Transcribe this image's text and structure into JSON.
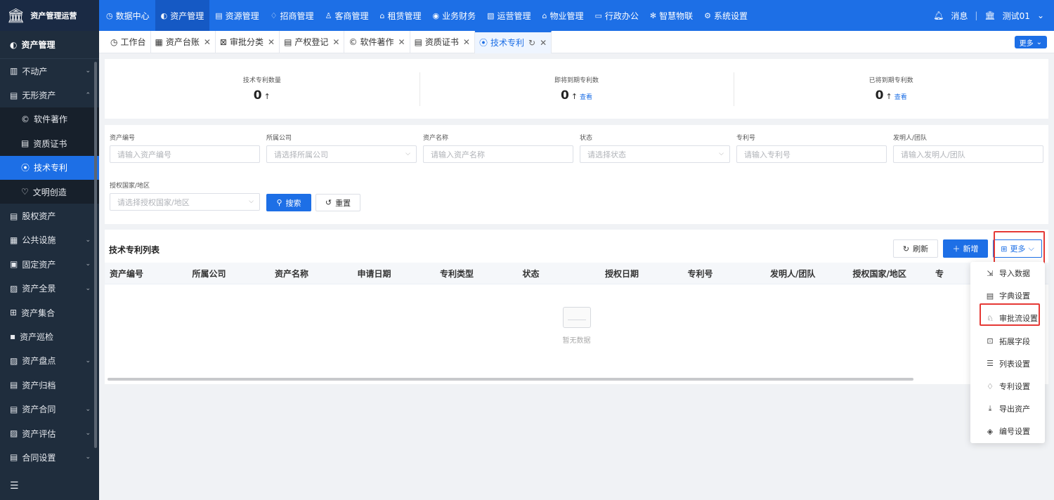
{
  "brand": {
    "name": "资产管理运营"
  },
  "topnav": [
    {
      "label": "数据中心",
      "icon": "◷"
    },
    {
      "label": "资产管理",
      "icon": "◐"
    },
    {
      "label": "资源管理",
      "icon": "▤"
    },
    {
      "label": "招商管理",
      "icon": "♢"
    },
    {
      "label": "客商管理",
      "icon": "♙"
    },
    {
      "label": "租赁管理",
      "icon": "⌂"
    },
    {
      "label": "业务财务",
      "icon": "◉"
    },
    {
      "label": "运营管理",
      "icon": "▧"
    },
    {
      "label": "物业管理",
      "icon": "⌂"
    },
    {
      "label": "行政办公",
      "icon": "▭"
    },
    {
      "label": "智慧物联",
      "icon": "✻"
    },
    {
      "label": "系统设置",
      "icon": "⚙"
    }
  ],
  "topright": {
    "messages": "消息",
    "user": "测试01"
  },
  "sidebar": {
    "title": "资产管理",
    "items": [
      {
        "label": "不动产",
        "icon": "▥",
        "chevron": "⌄"
      },
      {
        "label": "无形资产",
        "icon": "▤",
        "chevron": "⌃"
      },
      {
        "label": "股权资产",
        "icon": "▤",
        "chevron": ""
      },
      {
        "label": "公共设施",
        "icon": "▦",
        "chevron": "⌄"
      },
      {
        "label": "固定资产",
        "icon": "▣",
        "chevron": "⌄"
      },
      {
        "label": "资产全景",
        "icon": "▨",
        "chevron": "⌄"
      },
      {
        "label": "资产集合",
        "icon": "⊞",
        "chevron": ""
      },
      {
        "label": "资产巡检",
        "icon": "▪",
        "chevron": ""
      },
      {
        "label": "资产盘点",
        "icon": "▨",
        "chevron": "⌄"
      },
      {
        "label": "资产归档",
        "icon": "▤",
        "chevron": ""
      },
      {
        "label": "资产合同",
        "icon": "▤",
        "chevron": "⌄"
      },
      {
        "label": "资产评估",
        "icon": "▨",
        "chevron": "⌄"
      },
      {
        "label": "合同设置",
        "icon": "▤",
        "chevron": "⌄"
      }
    ],
    "subitems": [
      {
        "label": "软件著作",
        "icon": "©"
      },
      {
        "label": "资质证书",
        "icon": "▤"
      },
      {
        "label": "技术专利",
        "icon": "⦿"
      },
      {
        "label": "文明创造",
        "icon": "♡"
      }
    ]
  },
  "tabs": [
    {
      "label": "工作台",
      "icon": "◷"
    },
    {
      "label": "资产台账",
      "icon": "▦"
    },
    {
      "label": "审批分类",
      "icon": "⊠"
    },
    {
      "label": "产权登记",
      "icon": "▤"
    },
    {
      "label": "软件著作",
      "icon": "©"
    },
    {
      "label": "资质证书",
      "icon": "▤"
    },
    {
      "label": "技术专利",
      "icon": "⦿"
    }
  ],
  "tabs_more": "更多",
  "stats": [
    {
      "label": "技术专利数量",
      "value": "0",
      "arrow": "↑",
      "link": ""
    },
    {
      "label": "即将到期专利数",
      "value": "0",
      "arrow": "↑",
      "link": "查看"
    },
    {
      "label": "已将到期专利数",
      "value": "0",
      "arrow": "↑",
      "link": "查看"
    }
  ],
  "filters": [
    {
      "label": "资产编号",
      "placeholder": "请输入资产编号",
      "select": false
    },
    {
      "label": "所属公司",
      "placeholder": "请选择所属公司",
      "select": true
    },
    {
      "label": "资产名称",
      "placeholder": "请输入资产名称",
      "select": false
    },
    {
      "label": "状态",
      "placeholder": "请选择状态",
      "select": true
    },
    {
      "label": "专利号",
      "placeholder": "请输入专利号",
      "select": false
    },
    {
      "label": "发明人/团队",
      "placeholder": "请输入发明人/团队",
      "select": false
    },
    {
      "label": "授权国家/地区",
      "placeholder": "请选择授权国家/地区",
      "select": true
    }
  ],
  "buttons": {
    "search": "搜索",
    "reset": "重置",
    "refresh": "刷新",
    "add": "新增",
    "more": "更多"
  },
  "list": {
    "title": "技术专利列表",
    "columns": [
      "资产编号",
      "所属公司",
      "资产名称",
      "申请日期",
      "专利类型",
      "状态",
      "授权日期",
      "专利号",
      "发明人/团队",
      "授权国家/地区",
      "专"
    ],
    "empty": "暂无数据"
  },
  "more_menu": [
    {
      "label": "导入数据",
      "icon": "⇲"
    },
    {
      "label": "字典设置",
      "icon": "▤"
    },
    {
      "label": "审批流设置",
      "icon": "♘"
    },
    {
      "label": "拓展字段",
      "icon": "⊡"
    },
    {
      "label": "列表设置",
      "icon": "☰"
    },
    {
      "label": "专利设置",
      "icon": "♢"
    },
    {
      "label": "导出资产",
      "icon": "⤓"
    },
    {
      "label": "编号设置",
      "icon": "◈"
    }
  ],
  "colors": {
    "primary": "#1d6fe6",
    "sidebar": "#1f2d3d",
    "highlight": "#e53935"
  }
}
